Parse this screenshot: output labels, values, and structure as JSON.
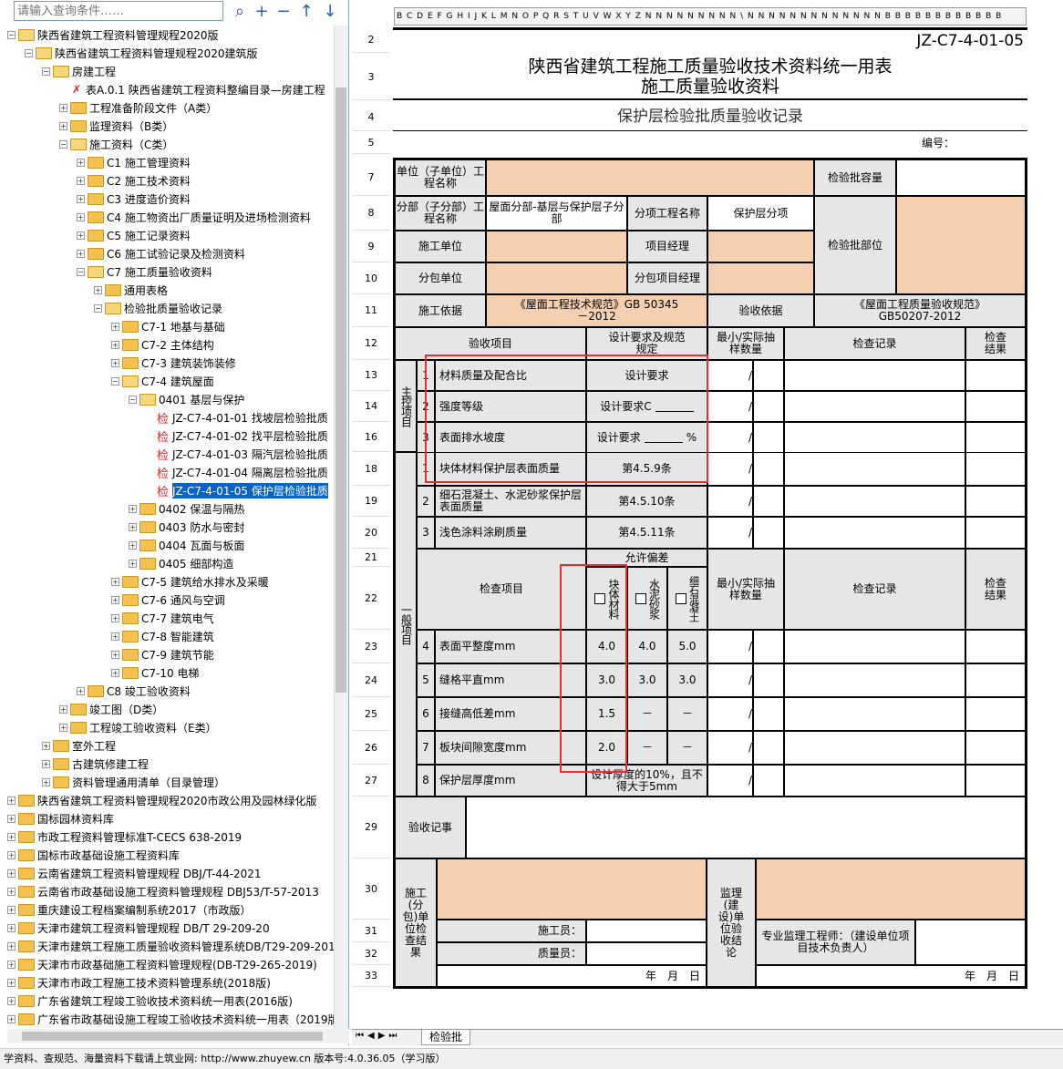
{
  "search": {
    "placeholder": "请输入查询条件……"
  },
  "toolbar": {
    "search_icon": "search-icon",
    "add_icon": "plus-icon",
    "remove_icon": "minus-icon",
    "up_icon": "arrow-up-icon",
    "down_icon": "arrow-down-icon"
  },
  "tree": [
    {
      "level": 0,
      "label": "陕西省建筑工程资料管理规程2020版",
      "type": "folder",
      "open": true
    },
    {
      "level": 1,
      "label": "陕西省建筑工程资料管理规程2020建筑版",
      "type": "folder",
      "open": true
    },
    {
      "level": 2,
      "label": "房建工程",
      "type": "folder",
      "open": true
    },
    {
      "level": 3,
      "label": "表A.0.1 陕西省建筑工程资料整编目录—房建工程",
      "type": "doc"
    },
    {
      "level": 3,
      "label": "工程准备阶段文件（A类）",
      "type": "folder"
    },
    {
      "level": 3,
      "label": "监理资料（B类）",
      "type": "folder"
    },
    {
      "level": 3,
      "label": "施工资料（C类）",
      "type": "folder",
      "open": true
    },
    {
      "level": 4,
      "label": "C1 施工管理资料",
      "type": "folder"
    },
    {
      "level": 4,
      "label": "C2 施工技术资料",
      "type": "folder"
    },
    {
      "level": 4,
      "label": "C3 进度造价资料",
      "type": "folder"
    },
    {
      "level": 4,
      "label": "C4 施工物资出厂质量证明及进场检测资料",
      "type": "folder"
    },
    {
      "level": 4,
      "label": "C5 施工记录资料",
      "type": "folder"
    },
    {
      "level": 4,
      "label": "C6 施工试验记录及检测资料",
      "type": "folder"
    },
    {
      "level": 4,
      "label": "C7 施工质量验收资料",
      "type": "folder",
      "open": true
    },
    {
      "level": 5,
      "label": "通用表格",
      "type": "folder"
    },
    {
      "level": 5,
      "label": "检验批质量验收记录",
      "type": "folder",
      "open": true
    },
    {
      "level": 6,
      "label": "C7-1 地基与基础",
      "type": "folder"
    },
    {
      "level": 6,
      "label": "C7-2 主体结构",
      "type": "folder"
    },
    {
      "level": 6,
      "label": "C7-3 建筑装饰装修",
      "type": "folder"
    },
    {
      "level": 6,
      "label": "C7-4 建筑屋面",
      "type": "folder",
      "open": true
    },
    {
      "level": 7,
      "label": "0401 基层与保护",
      "type": "folder",
      "open": true
    },
    {
      "level": 8,
      "label": "JZ-C7-4-01-01 找坡层检验批质",
      "type": "jian"
    },
    {
      "level": 8,
      "label": "JZ-C7-4-01-02 找平层检验批质",
      "type": "jian"
    },
    {
      "level": 8,
      "label": "JZ-C7-4-01-03 隔汽层检验批质",
      "type": "jian"
    },
    {
      "level": 8,
      "label": "JZ-C7-4-01-04 隔离层检验批质",
      "type": "jian"
    },
    {
      "level": 8,
      "label": "JZ-C7-4-01-05 保护层检验批质",
      "type": "jian",
      "selected": true
    },
    {
      "level": 7,
      "label": "0402 保温与隔热",
      "type": "folder"
    },
    {
      "level": 7,
      "label": "0403 防水与密封",
      "type": "folder"
    },
    {
      "level": 7,
      "label": "0404 瓦面与板面",
      "type": "folder"
    },
    {
      "level": 7,
      "label": "0405 细部构造",
      "type": "folder"
    },
    {
      "level": 6,
      "label": "C7-5 建筑给水排水及采暖",
      "type": "folder"
    },
    {
      "level": 6,
      "label": "C7-6 通风与空调",
      "type": "folder"
    },
    {
      "level": 6,
      "label": "C7-7 建筑电气",
      "type": "folder"
    },
    {
      "level": 6,
      "label": "C7-8 智能建筑",
      "type": "folder"
    },
    {
      "level": 6,
      "label": "C7-9 建筑节能",
      "type": "folder"
    },
    {
      "level": 6,
      "label": "C7-10 电梯",
      "type": "folder"
    },
    {
      "level": 4,
      "label": "C8 竣工验收资料",
      "type": "folder"
    },
    {
      "level": 3,
      "label": "竣工图（D类）",
      "type": "folder"
    },
    {
      "level": 3,
      "label": "工程竣工验收资料（E类）",
      "type": "folder"
    },
    {
      "level": 2,
      "label": "室外工程",
      "type": "folder"
    },
    {
      "level": 2,
      "label": "古建筑修建工程",
      "type": "folder"
    },
    {
      "level": 2,
      "label": "资料管理通用清单（目录管理）",
      "type": "folder"
    },
    {
      "level": 0,
      "label": "陕西省建筑工程资料管理规程2020市政公用及园林绿化版",
      "type": "folder"
    },
    {
      "level": 0,
      "label": "国标园林资料库",
      "type": "folder"
    },
    {
      "level": 0,
      "label": "市政工程资料管理标准T-CECS 638-2019",
      "type": "folder"
    },
    {
      "level": 0,
      "label": "国标市政基础设施工程资料库",
      "type": "folder"
    },
    {
      "level": 0,
      "label": "云南省建筑工程资料管理规程 DBJ/T-44-2021",
      "type": "folder"
    },
    {
      "level": 0,
      "label": "云南省市政基础设施工程资料管理规程 DBJ53/T-57-2013",
      "type": "folder"
    },
    {
      "level": 0,
      "label": "重庆建设工程档案编制系统2017（市政版）",
      "type": "folder"
    },
    {
      "level": 0,
      "label": "天津市建筑工程资料管理规程 DB/T 29-209-20",
      "type": "folder"
    },
    {
      "level": 0,
      "label": "天津市建筑工程施工质量验收资料管理系统DB/T29-209-2011",
      "type": "folder"
    },
    {
      "level": 0,
      "label": "天津市市政基础施工程资料管理规程(DB-T29-265-2019)",
      "type": "folder"
    },
    {
      "level": 0,
      "label": "天津市市政工程施工技术资料管理系统(2018版)",
      "type": "folder"
    },
    {
      "level": 0,
      "label": "广东省建筑工程竣工验收技术资料统一用表(2016版)",
      "type": "folder"
    },
    {
      "level": 0,
      "label": "广东省市政基础设施工程竣工验收技术资料统一用表（2019版",
      "type": "folder"
    }
  ],
  "sheet": {
    "col_letters": "B C D E F G H I J K L M N O P Q R S T U V W X Y Z N N N N N N N N N \\ N N N N N N N N N N N N N B B B B B B B B B B B B",
    "row_numbers": [
      "2",
      "3",
      "4",
      "5",
      "7",
      "8",
      "9",
      "10",
      "11",
      "12",
      "13",
      "14",
      "16",
      "18",
      "19",
      "20",
      "21",
      "22",
      "23",
      "24",
      "25",
      "26",
      "27",
      "29",
      "30",
      "31",
      "32",
      "33"
    ],
    "form_code": "JZ-C7-4-01-05",
    "title1": "陕西省建筑工程施工质量验收技术资料统一用表",
    "title2": "施工质量验收资料",
    "record_title": "保护层检验批质量验收记录",
    "serial_label": "编号：",
    "unit_name_label": "单位（子单位）工程名称",
    "batch_capacity_label": "检验批容量",
    "division_label": "分部（子分部）工程名称",
    "division_value": "屋面分部-基层与保护层子分部",
    "subitem_label": "分项工程名称",
    "subitem_value": "保护层分项",
    "constructor_label": "施工单位",
    "pm_label": "项目经理",
    "batch_location_label": "检验批部位",
    "subcontractor_label": "分包单位",
    "sub_pm_label": "分包项目经理",
    "basis_label": "施工依据",
    "basis_value": "《屋面工程技术规范》GB 50345－2012",
    "acceptance_basis_label": "验收依据",
    "acceptance_basis_value": "《屋面工程质量验收规范》GB50207-2012",
    "h_item": "验收项目",
    "h_req": "设计要求及规范规定",
    "h_min": "最小/实际抽样数量",
    "h_record": "检查记录",
    "h_result": "检查结果",
    "main_label": "主控项目",
    "general_label": "一般项目",
    "main_items": [
      {
        "no": "1",
        "name": "材料质量及配合比",
        "req": "设计要求",
        "slash": "/"
      },
      {
        "no": "2",
        "name": "强度等级",
        "req": "设计要求C",
        "slash": "/"
      },
      {
        "no": "3",
        "name": "表面排水坡度",
        "req": "设计要求",
        "unit": "%",
        "slash": "/"
      }
    ],
    "gen_items_a": [
      {
        "no": "1",
        "name": "块体材料保护层表面质量",
        "req": "第4.5.9条",
        "slash": "/"
      },
      {
        "no": "2",
        "name": "细石混凝土、水泥砂浆保护层表面质量",
        "req": "第4.5.10条",
        "slash": "/"
      },
      {
        "no": "3",
        "name": "浅色涂料涂刷质量",
        "req": "第4.5.11条",
        "slash": "/"
      }
    ],
    "allow_dev": "允许偏差",
    "check_item": "检查项目",
    "col_block": "块体材料",
    "col_cement": "水泥砂浆",
    "col_concrete": "细石混凝土",
    "gen_items_b": [
      {
        "no": "4",
        "name": "表面平整度mm",
        "a": "4.0",
        "b": "4.0",
        "c": "5.0",
        "slash": "/"
      },
      {
        "no": "5",
        "name": "缝格平直mm",
        "a": "3.0",
        "b": "3.0",
        "c": "3.0",
        "slash": "/"
      },
      {
        "no": "6",
        "name": "接缝高低差mm",
        "a": "1.5",
        "b": "－",
        "c": "－",
        "slash": "/"
      },
      {
        "no": "7",
        "name": "板块间隙宽度mm",
        "a": "2.0",
        "b": "－",
        "c": "－",
        "slash": "/"
      }
    ],
    "item8": {
      "no": "8",
      "name": "保护层厚度mm",
      "req": "设计厚度的10%，且不得大于5mm",
      "slash": "/"
    },
    "notes_label": "验收记事",
    "constructor_conclusion": "施工(分包)单位检查结果",
    "supervisor_conclusion": "监理(建设)单位验收结论",
    "worker_label": "施工员：",
    "qc_label": "质量员：",
    "engineer_label": "专业监理工程师：（建设单位项目技术负责人）",
    "date_left": "年　月　日",
    "date_right": "年　月　日"
  },
  "sheet_tab": "检验批",
  "status_bar": "学资料、查规范、海量资料下载请上筑业网:  http://www.zhuyew.cn  版本号:4.0.36.05（学习版）",
  "colors": {
    "accent_orange": "#f5d0b0",
    "highlight_red": "#e53030",
    "selection_blue": "#0a64c8",
    "grey_header": "#e6e6e6"
  }
}
